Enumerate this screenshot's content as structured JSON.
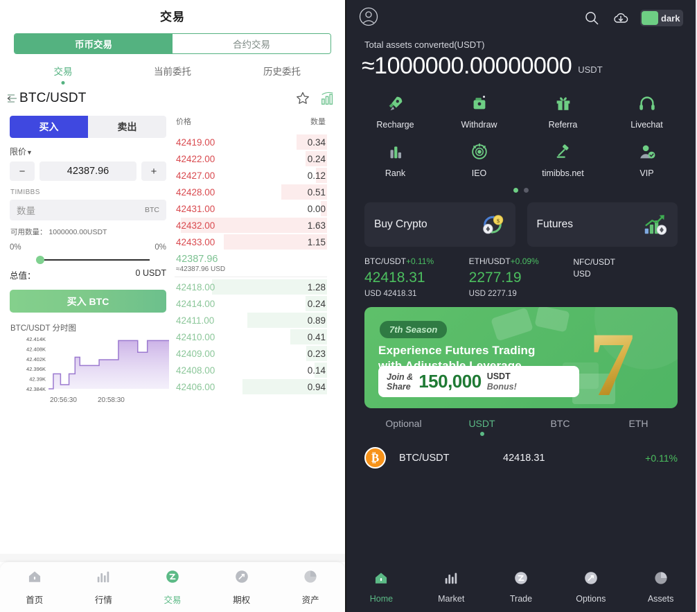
{
  "left": {
    "title": "交易",
    "segments": [
      {
        "label": "币币交易",
        "active": true
      },
      {
        "label": "合约交易",
        "active": false
      }
    ],
    "tabs": [
      {
        "label": "交易",
        "active": true
      },
      {
        "label": "当前委托",
        "active": false
      },
      {
        "label": "历史委托",
        "active": false
      }
    ],
    "pair": "BTC/USDT",
    "icons": {
      "back": "back-arrow-icon",
      "star": "star-icon",
      "chart": "chart-bars-icon"
    },
    "side_buy": "买入",
    "side_sell": "卖出",
    "order_type": "限价",
    "price_value": "42387.96",
    "minus": "−",
    "plus": "+",
    "brand": "TIMIBBS",
    "amount_placeholder": "数量",
    "amount_unit": "BTC",
    "available": "可用数量： 1000000.00USDT",
    "pct_left": "0%",
    "pct_right": "0%",
    "total_label": "总值：",
    "total_value": "0 USDT",
    "submit": "买入 BTC",
    "chart_title": "BTC/USDT 分时图",
    "book": {
      "col_price": "价格",
      "col_amount": "数量",
      "asks": [
        {
          "price": "42419.00",
          "amount": "0.34"
        },
        {
          "price": "42422.00",
          "amount": "0.24"
        },
        {
          "price": "42427.00",
          "amount": "0.12"
        },
        {
          "price": "42428.00",
          "amount": "0.51"
        },
        {
          "price": "42431.00",
          "amount": "0.00"
        },
        {
          "price": "42432.00",
          "amount": "1.63"
        },
        {
          "price": "42433.00",
          "amount": "1.15"
        }
      ],
      "mid_price": "42387.96",
      "mid_sub": "≈42387.96 USD",
      "bids": [
        {
          "price": "42418.00",
          "amount": "1.28"
        },
        {
          "price": "42414.00",
          "amount": "0.24"
        },
        {
          "price": "42411.00",
          "amount": "0.89"
        },
        {
          "price": "42410.00",
          "amount": "0.41"
        },
        {
          "price": "42409.00",
          "amount": "0.23"
        },
        {
          "price": "42408.00",
          "amount": "0.14"
        },
        {
          "price": "42406.00",
          "amount": "0.94"
        }
      ]
    },
    "nav": [
      {
        "label": "首页",
        "icon": "home-icon",
        "active": false
      },
      {
        "label": "行情",
        "icon": "market-bars-icon",
        "active": false
      },
      {
        "label": "交易",
        "icon": "trade-icon",
        "active": true
      },
      {
        "label": "期权",
        "icon": "options-icon",
        "active": false
      },
      {
        "label": "资产",
        "icon": "assets-pie-icon",
        "active": false
      }
    ]
  },
  "chart_data": {
    "type": "area",
    "title": "BTC/USDT 分时图",
    "xlabel": "",
    "ylabel": "",
    "ytick_labels": [
      "42.414K",
      "42.408K",
      "42.402K",
      "42.396K",
      "42.39K",
      "42.384K"
    ],
    "ylim": [
      42384,
      42414
    ],
    "xtick_labels": [
      "20:56:30",
      "20:58:30"
    ],
    "line_color": "#9b79cf",
    "fill_color": "#cdb6e8",
    "grid": false,
    "legend": "none",
    "x": [
      0,
      4,
      8,
      10,
      14,
      17,
      20,
      22,
      26,
      30,
      34,
      38,
      42,
      46,
      50,
      54,
      58,
      62,
      66,
      70,
      74,
      78,
      82,
      86,
      90,
      94,
      100
    ],
    "values": [
      42384,
      42393,
      42393,
      42386.5,
      42386.5,
      42393,
      42393,
      42403,
      42398,
      42398,
      42398,
      42398,
      42401.5,
      42401.5,
      42401.5,
      42401.5,
      42413,
      42413,
      42413,
      42413,
      42406,
      42406,
      42413,
      42413,
      42413,
      42413,
      42413
    ]
  },
  "right": {
    "header": {
      "avatar": "user-avatar-icon",
      "search": "search-icon",
      "download": "download-cloud-icon",
      "theme_label": "dark"
    },
    "total_label": "Total assets converted(USDT)",
    "total_value": "≈1000000.00000000",
    "total_currency": "USDT",
    "shortcuts": [
      {
        "label": "Recharge",
        "icon": "rocket-icon"
      },
      {
        "label": "Withdraw",
        "icon": "withdraw-wallet-icon"
      },
      {
        "label": "Referra",
        "icon": "gift-icon"
      },
      {
        "label": "Livechat",
        "icon": "headset-icon"
      },
      {
        "label": "Rank",
        "icon": "rank-bars-icon"
      },
      {
        "label": "IEO",
        "icon": "ieo-atom-icon"
      },
      {
        "label": "timibbs.net",
        "icon": "gavel-icon"
      },
      {
        "label": "VIP",
        "icon": "vip-user-icon"
      }
    ],
    "page_dots": 2,
    "page_dot_active": 0,
    "cards": [
      {
        "title": "Buy Crypto",
        "icon": "exchange-coins-icon"
      },
      {
        "title": "Futures",
        "icon": "futures-growth-icon"
      }
    ],
    "tickers": [
      {
        "pair": "BTC/USDT",
        "change": "+0.11%",
        "price": "42418.31",
        "usd": "USD 42418.31"
      },
      {
        "pair": "ETH/USDT",
        "change": "+0.09%",
        "price": "2277.19",
        "usd": "USD 2277.19"
      },
      {
        "pair": "NFC/USDT",
        "change": "",
        "price": "",
        "usd": "USD"
      }
    ],
    "banner": {
      "season": "7th Season",
      "headline_line1": "Experience Futures Trading",
      "headline_line2": "with Adjustable Leverage",
      "join": "Join &",
      "share": "Share",
      "amount": "150,000",
      "usdt": "USDT",
      "bonus": "Bonus!",
      "big_number": "7"
    },
    "market_tabs": [
      {
        "label": "Optional",
        "active": false
      },
      {
        "label": "USDT",
        "active": true
      },
      {
        "label": "BTC",
        "active": false
      },
      {
        "label": "ETH",
        "active": false
      }
    ],
    "market_rows": [
      {
        "symbol": "₿",
        "name": "BTC/USDT",
        "price": "42418.31",
        "change": "+0.11%"
      }
    ],
    "nav": [
      {
        "label": "Home",
        "icon": "home-icon",
        "active": true
      },
      {
        "label": "Market",
        "icon": "market-bars-icon",
        "active": false
      },
      {
        "label": "Trade",
        "icon": "trade-icon",
        "active": false
      },
      {
        "label": "Options",
        "icon": "options-icon",
        "active": false
      },
      {
        "label": "Assets",
        "icon": "assets-pie-icon",
        "active": false
      }
    ]
  },
  "colors": {
    "green": "#54b280",
    "blue": "#3f48e0",
    "ask_red": "#d94a4f",
    "bid_green": "#8cc79a",
    "dark_bg": "#22242e"
  }
}
